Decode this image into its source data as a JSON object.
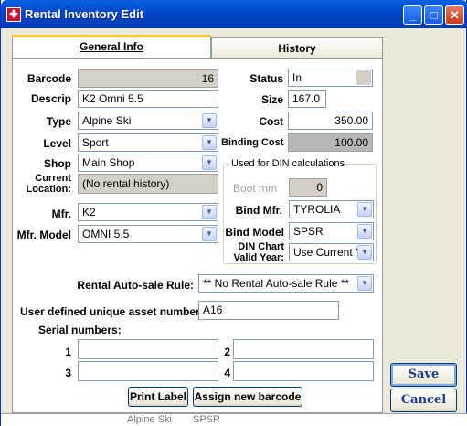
{
  "window": {
    "title": "Rental Inventory Edit"
  },
  "tabs": [
    {
      "label": "General Info"
    },
    {
      "label": "History"
    }
  ],
  "form": {
    "barcode": {
      "label": "Barcode",
      "value": "16"
    },
    "descrip": {
      "label": "Descrip",
      "value": "K2 Omni 5.5"
    },
    "type": {
      "label": "Type",
      "value": "Alpine Ski"
    },
    "level": {
      "label": "Level",
      "value": "Sport"
    },
    "shop": {
      "label": "Shop",
      "value": "Main Shop"
    },
    "current_location": {
      "label_line1": "Current",
      "label_line2": "Location:",
      "value": "(No rental history)"
    },
    "mfr": {
      "label": "Mfr.",
      "value": "K2"
    },
    "mfr_model": {
      "label": "Mfr. Model",
      "value": "OMNI 5.5"
    },
    "status": {
      "label": "Status",
      "value": "In"
    },
    "size": {
      "label": "Size",
      "value": "167.0"
    },
    "cost": {
      "label": "Cost",
      "value": "350.00"
    },
    "binding_cost": {
      "label": "Binding Cost",
      "value": "100.00"
    },
    "din_group": {
      "title": "Used for DIN calculations"
    },
    "boot_mm": {
      "label": "Boot mm",
      "value": "0"
    },
    "bind_mfr": {
      "label": "Bind Mfr.",
      "value": "TYROLIA"
    },
    "bind_model": {
      "label": "Bind Model",
      "value": "SPSR"
    },
    "din_chart": {
      "label_line1": "DIN Chart",
      "label_line2": "Valid Year:",
      "value": "Use Current Y"
    },
    "auto_sale_rule": {
      "label": "Rental Auto-sale Rule:",
      "value": "** No Rental Auto-sale Rule **"
    },
    "asset_number": {
      "label": "User defined unique asset number:",
      "value": "A16"
    },
    "serials": {
      "label": "Serial numbers:",
      "items": [
        {
          "num": "1",
          "value": ""
        },
        {
          "num": "2",
          "value": ""
        },
        {
          "num": "3",
          "value": ""
        },
        {
          "num": "4",
          "value": ""
        }
      ]
    }
  },
  "buttons": {
    "print_label": "Print Label",
    "assign_barcode": "Assign new barcode",
    "save": "Save",
    "cancel": "Cancel"
  },
  "background_row": {
    "text1": "Alpine Ski",
    "text2": "SPSR"
  }
}
